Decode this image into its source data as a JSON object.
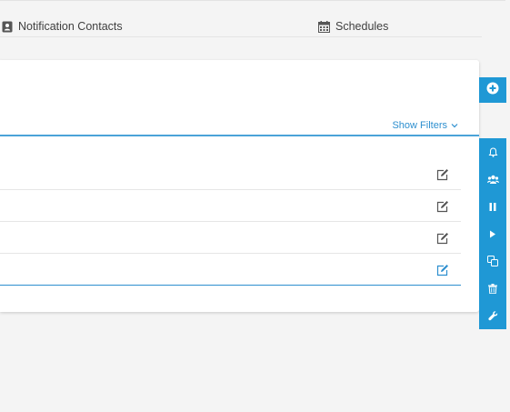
{
  "tabs": {
    "notification_contacts": "Notification Contacts",
    "schedules": "Schedules"
  },
  "panel": {
    "show_filters_label": "Show Filters"
  },
  "rows": [
    {
      "edit_icon": "edit-icon"
    },
    {
      "edit_icon": "edit-icon"
    },
    {
      "edit_icon": "edit-icon"
    },
    {
      "edit_icon": "edit-icon-active"
    }
  ],
  "side_actions": {
    "add": "plus-circle-icon",
    "tools": [
      "bell-icon",
      "users-icon",
      "pause-icon",
      "play-icon",
      "copy-icon",
      "trash-icon",
      "wrench-icon"
    ]
  },
  "colors": {
    "accent": "#1f98d5",
    "link": "#2d8fcf",
    "background": "#f4f4f4",
    "panel": "#ffffff"
  }
}
